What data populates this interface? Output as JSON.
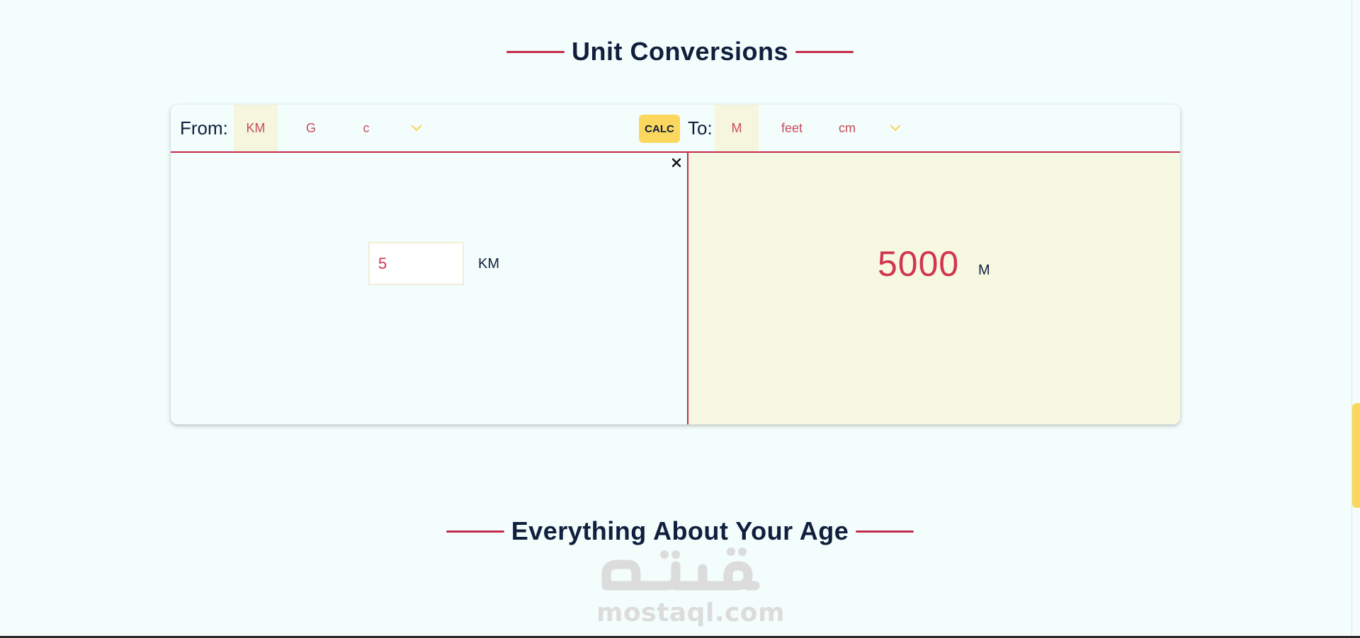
{
  "unit_section": {
    "title": "Unit Conversions",
    "from_label": "From:",
    "to_label": "To:",
    "calc_label": "CALC",
    "from_units": [
      "KM",
      "G",
      "c"
    ],
    "to_units": [
      "M",
      "feet",
      "cm"
    ],
    "input_value": "5",
    "from_unit_display": "KM",
    "result_value": "5000",
    "to_unit_display": "M"
  },
  "age_section": {
    "title": "Everything About Your Age"
  },
  "watermark": {
    "latin": "mostaql.com"
  },
  "colors": {
    "accent_red": "#c42a4b",
    "accent_yellow": "#fbd85d",
    "background": "#f2fdfc",
    "result_bg": "#f6f8e1",
    "heading": "#0f1f3d"
  },
  "icons": {
    "close": "close-icon",
    "dropdown": "chevron-down-icon"
  }
}
